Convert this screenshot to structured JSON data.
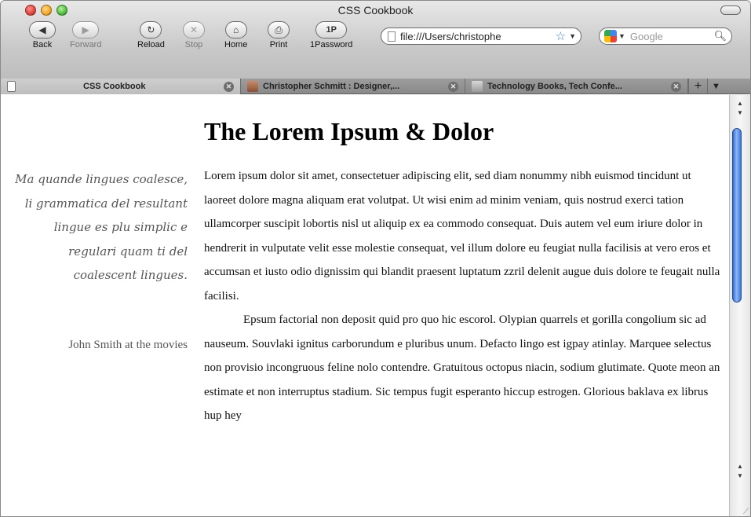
{
  "window": {
    "title": "CSS Cookbook"
  },
  "toolbar": {
    "back_label": "Back",
    "forward_label": "Forward",
    "reload_label": "Reload",
    "stop_label": "Stop",
    "home_label": "Home",
    "print_label": "Print",
    "onepassword_label": "1Password",
    "onepassword_icon_text": "1P"
  },
  "address_bar": {
    "value": "file:///Users/christophe"
  },
  "search_bar": {
    "placeholder": "Google"
  },
  "tabs": [
    {
      "label": "CSS Cookbook",
      "active": true,
      "icon": "document-icon"
    },
    {
      "label": "Christopher Schmitt : Designer,...",
      "active": false,
      "icon": "photo-icon"
    },
    {
      "label": "Technology Books, Tech Confe...",
      "active": false,
      "icon": "books-icon"
    }
  ],
  "page": {
    "heading": "The Lorem Ipsum & Dolor",
    "pullquote": "Ma quande lingues coalesce, li grammatica del resultant lingue es plu simplic e regulari quam ti del coalescent lingues.",
    "attribution": "John Smith at the movies",
    "paragraphs": [
      "Lorem ipsum dolor sit amet, consectetuer adipiscing elit, sed diam nonummy nibh euismod tincidunt ut laoreet dolore magna aliquam erat volutpat. Ut wisi enim ad minim veniam, quis nostrud exerci tation ullamcorper suscipit lobortis nisl ut aliquip ex ea commodo consequat. Duis autem vel eum iriure dolor in hendrerit in vulputate velit esse molestie consequat, vel illum dolore eu feugiat nulla facilisis at vero eros et accumsan et iusto odio dignissim qui blandit praesent luptatum zzril delenit augue duis dolore te feugait nulla facilisi.",
      "Epsum factorial non deposit quid pro quo hic escorol. Olypian quarrels et gorilla congolium sic ad nauseum. Souvlaki ignitus carborundum e pluribus unum. Defacto lingo est igpay atinlay. Marquee selectus non provisio incongruous feline nolo contendre. Gratuitous octopus niacin, sodium glutimate. Quote meon an estimate et non interruptus stadium. Sic tempus fugit esperanto hiccup estrogen. Glorious baklava ex librus hup hey"
    ]
  },
  "colors": {
    "scroll_thumb": "#3a79df",
    "quote_text": "#555555"
  }
}
